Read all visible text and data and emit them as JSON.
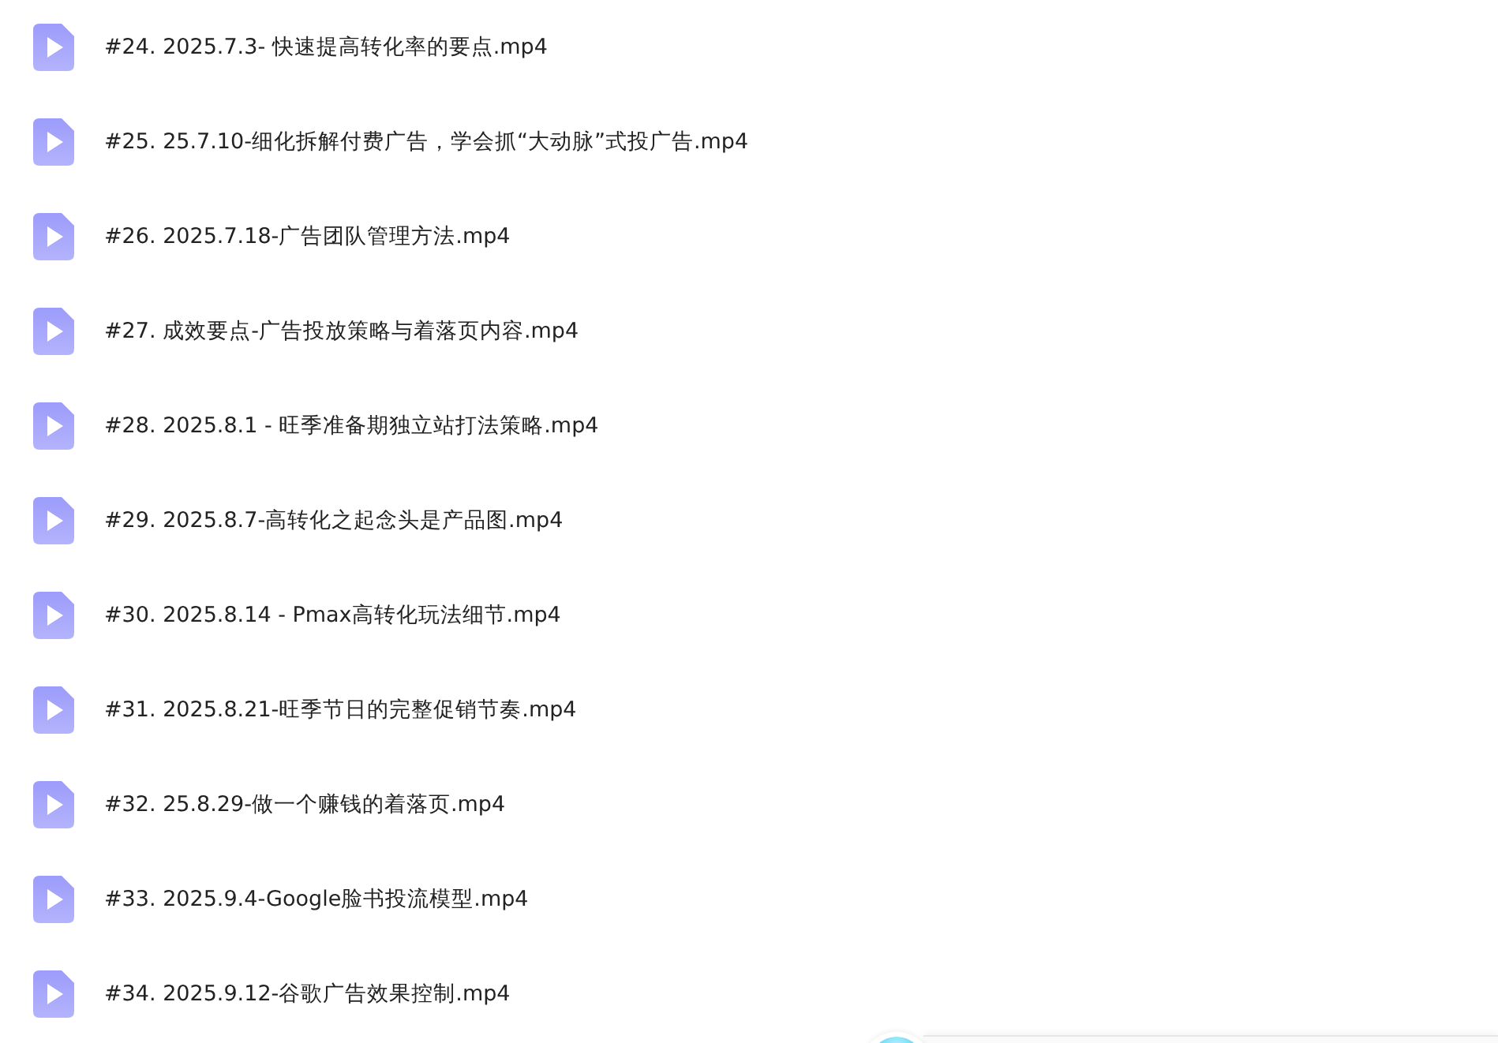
{
  "files": [
    {
      "name": "#24. 2025.7.3- 快速提高转化率的要点.mp4",
      "kind": "video"
    },
    {
      "name": "#25. 25.7.10-细化拆解付费广告，学会抓“大动脉”式投广告.mp4",
      "kind": "video"
    },
    {
      "name": "#26. 2025.7.18-广告团队管理方法.mp4",
      "kind": "video"
    },
    {
      "name": "#27. 成效要点-广告投放策略与着落页内容.mp4",
      "kind": "video"
    },
    {
      "name": "#28. 2025.8.1 - 旺季准备期独立站打法策略.mp4",
      "kind": "video"
    },
    {
      "name": "#29. 2025.8.7-高转化之起念头是产品图.mp4",
      "kind": "video"
    },
    {
      "name": "#30. 2025.8.14 - Pmax高转化玩法细节.mp4",
      "kind": "video"
    },
    {
      "name": "#31. 2025.8.21-旺季节日的完整促销节奏.mp4",
      "kind": "video"
    },
    {
      "name": "#32. 25.8.29-做一个赚钱的着落页.mp4",
      "kind": "video"
    },
    {
      "name": "#33. 2025.9.4-Google脸书投流模型.mp4",
      "kind": "video"
    },
    {
      "name": "#34. 2025.9.12-谷歌广告效果控制.mp4",
      "kind": "video"
    }
  ]
}
